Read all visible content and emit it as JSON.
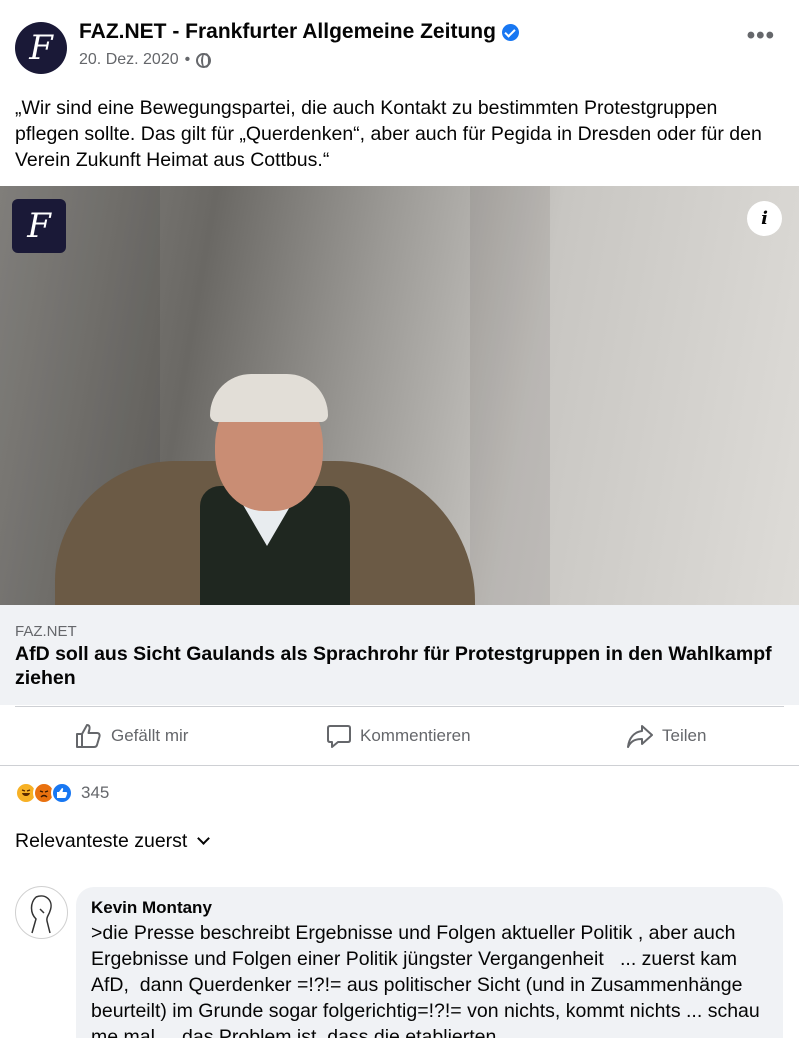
{
  "post": {
    "page_name": "FAZ.NET - Frankfurter Allgemeine Zeitung",
    "date": "20. Dez. 2020",
    "separator": "•",
    "text": "„Wir sind eine Bewegungspartei, die auch Kontakt zu bestimmten Protestgruppen pflegen sollte. Das gilt für „Querdenken“, aber auch für Pegida in Dresden oder für den Verein Zukunft Heimat aus Cottbus.“",
    "avatar_letter": "F",
    "more_label": "•••"
  },
  "link": {
    "logo_letter": "F",
    "info_label": "i",
    "domain": "FAZ.NET",
    "title": "AfD soll aus Sicht Gaulands als Sprachrohr für Protestgruppen in den Wahlkampf ziehen"
  },
  "actions": {
    "like": "Gefällt mir",
    "comment": "Kommentieren",
    "share": "Teilen"
  },
  "reactions": {
    "types": [
      "haha",
      "angry",
      "like"
    ],
    "count": "345"
  },
  "sort": {
    "label": "Relevanteste zuerst"
  },
  "comment": {
    "author": "Kevin Montany",
    "text": ">die Presse beschreibt Ergebnisse und Folgen aktueller Politik , aber auch Ergebnisse und Folgen einer Politik jüngster Vergangenheit   ... zuerst kam AfD,  dann Querdenker =!?!= aus politischer Sicht (und in Zusammenhänge beurteilt) im Grunde sogar folgerichtig=!?!= von nichts, kommt nichts ... schau me mal ... das Problem ist, dass die etablierten"
  },
  "colors": {
    "accent": "#1877f2",
    "secondary_text": "#65676b",
    "link_bg": "#f0f2f5",
    "brand_navy": "#1a1937"
  }
}
